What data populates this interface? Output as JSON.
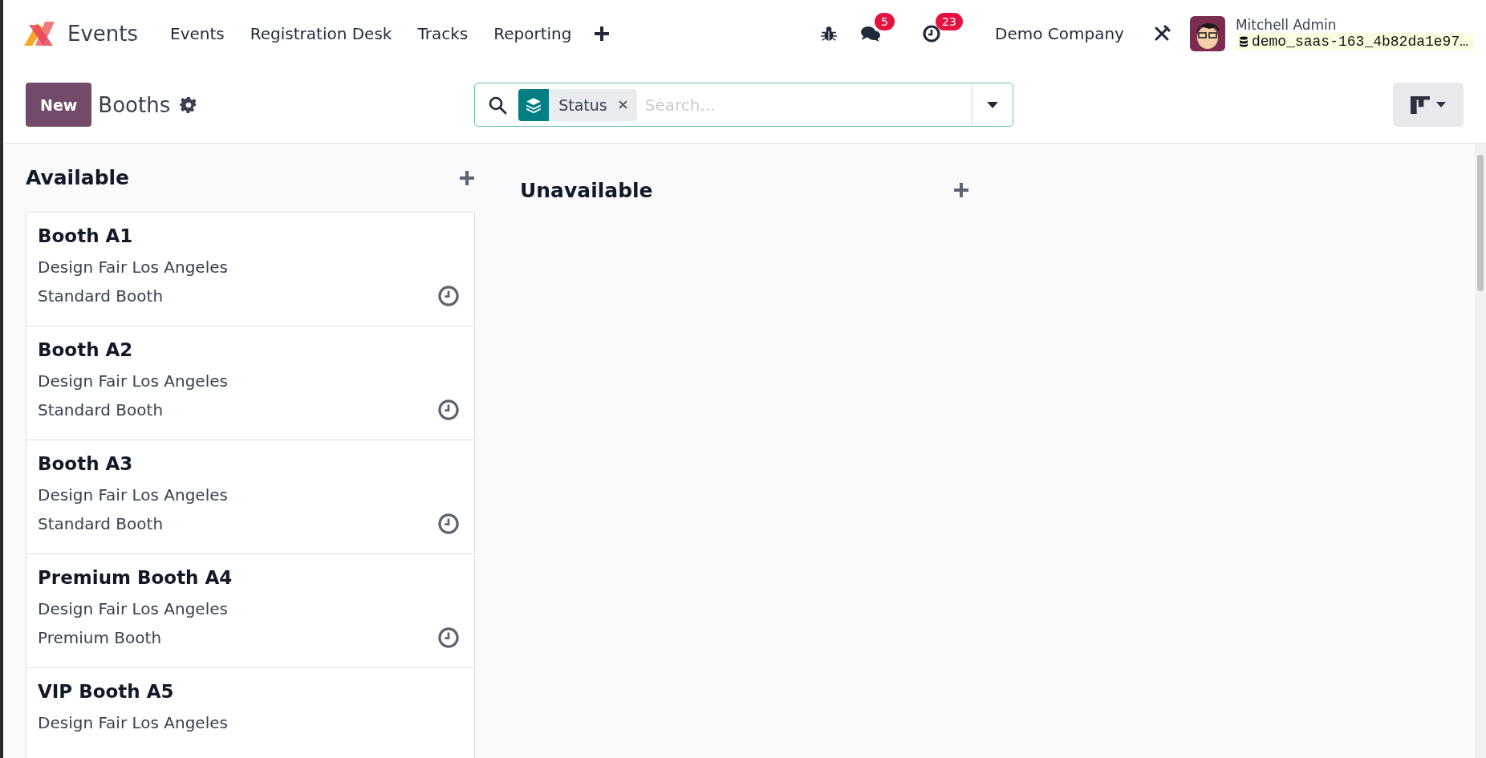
{
  "navbar": {
    "app_name": "Events",
    "menu": [
      {
        "label": "Events"
      },
      {
        "label": "Registration Desk"
      },
      {
        "label": "Tracks"
      },
      {
        "label": "Reporting"
      }
    ],
    "chat_badge": "5",
    "activity_badge": "23",
    "company": "Demo Company",
    "user": {
      "name": "Mitchell Admin",
      "database": "demo_saas-163_4b82da1e97…"
    }
  },
  "control_panel": {
    "new_button": "New",
    "title": "Booths",
    "search": {
      "facets": [
        {
          "label": "Status"
        }
      ],
      "placeholder": "Search..."
    }
  },
  "kanban": {
    "columns": [
      {
        "title": "Available",
        "cards": [
          {
            "title": "Booth A1",
            "event": "Design Fair Los Angeles",
            "booth_type": "Standard Booth"
          },
          {
            "title": "Booth A2",
            "event": "Design Fair Los Angeles",
            "booth_type": "Standard Booth"
          },
          {
            "title": "Booth A3",
            "event": "Design Fair Los Angeles",
            "booth_type": "Standard Booth"
          },
          {
            "title": "Premium Booth A4",
            "event": "Design Fair Los Angeles",
            "booth_type": "Premium Booth"
          },
          {
            "title": "VIP Booth A5",
            "event": "Design Fair Los Angeles"
          }
        ]
      },
      {
        "title": "Unavailable"
      }
    ]
  }
}
